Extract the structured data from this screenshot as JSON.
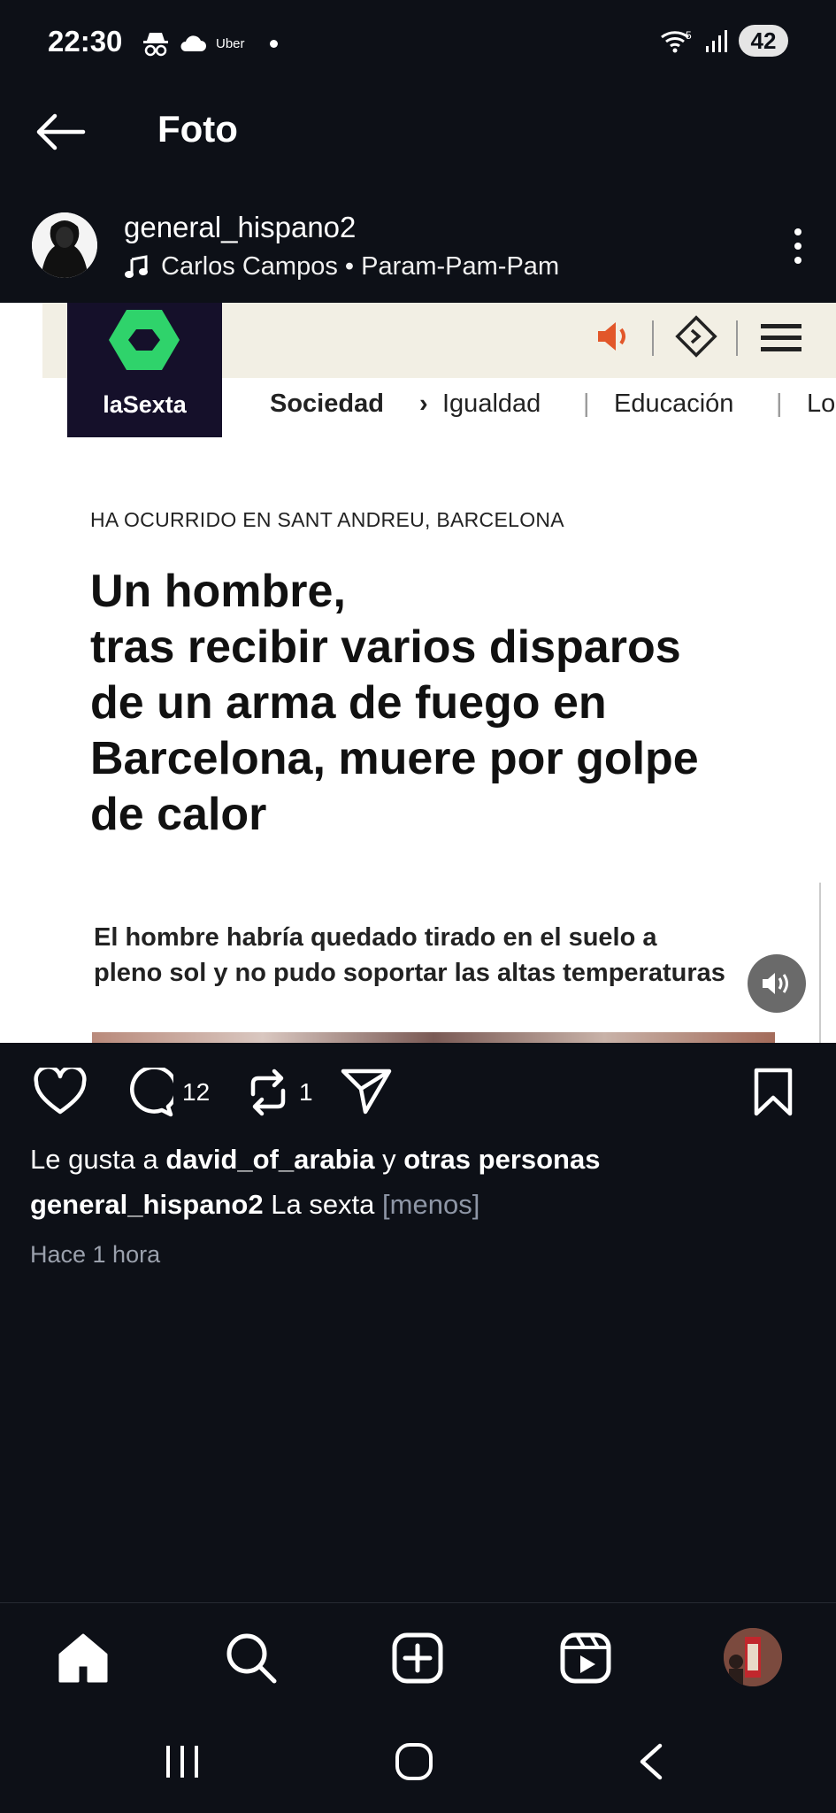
{
  "status_bar": {
    "time": "22:30",
    "uber_label": "Uber",
    "wifi_badge": "5",
    "battery": "42"
  },
  "header": {
    "title": "Foto"
  },
  "post": {
    "username": "general_hispano2",
    "music": "Carlos Campos • Param-Pam-Pam",
    "comments_count": "12",
    "reposts_count": "1"
  },
  "article": {
    "logo_text": "laSexta",
    "nav": [
      "Sociedad",
      "Igualdad",
      "Educación",
      "Lo"
    ],
    "kicker": "HA OCURRIDO EN SANT ANDREU, BARCELONA",
    "headline_lines": [
      "Un hombre,",
      "tras recibir varios disparos",
      "de un arma de fuego en",
      "Barcelona, muere por golpe",
      "de calor"
    ],
    "subhead_lines": [
      "El hombre habría quedado tirado en el suelo a",
      "pleno sol y no pudo soportar las altas temperaturas"
    ]
  },
  "likes": {
    "prefix": "Le gusta a",
    "user": "david_of_arabia",
    "connector": "y",
    "others": "otras personas"
  },
  "caption": {
    "user": "general_hispano2",
    "text": "La sexta",
    "toggle": "[menos]"
  },
  "timestamp": "Hace 1 hora",
  "colors": {
    "background": "#0d1017",
    "logo_green": "#2fd36b",
    "logo_bg": "#15102a",
    "speaker_orange": "#e2572a"
  }
}
